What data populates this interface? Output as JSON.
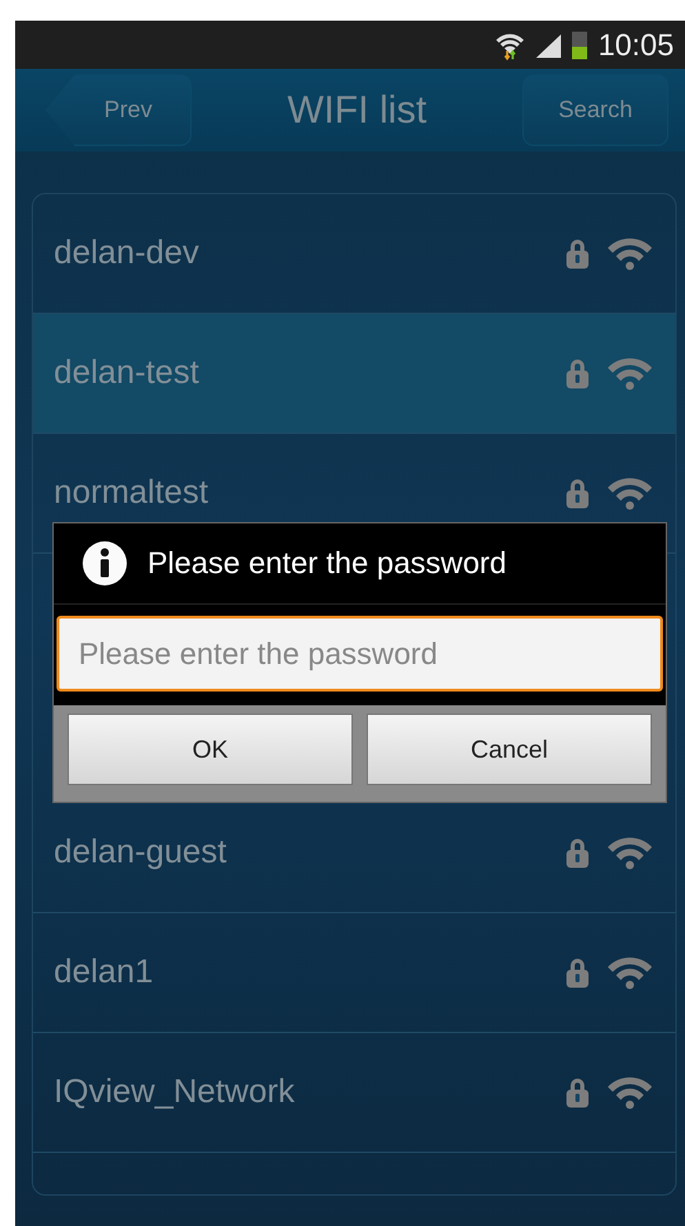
{
  "status_bar": {
    "time": "10:05"
  },
  "header": {
    "back_button": "Prev",
    "title": "WIFI list",
    "action_button": "Search"
  },
  "networks": [
    {
      "name": "delan-dev",
      "secured": true,
      "selected": false
    },
    {
      "name": "delan-test",
      "secured": true,
      "selected": true
    },
    {
      "name": "normaltest",
      "secured": true,
      "selected": false
    },
    {
      "name": "delan-guest",
      "secured": true,
      "selected": false
    },
    {
      "name": "delan1",
      "secured": true,
      "selected": false
    },
    {
      "name": "IQview_Network",
      "secured": true,
      "selected": false
    }
  ],
  "dialog": {
    "title": "Please enter the password",
    "password_field": {
      "placeholder": "Please enter the password"
    },
    "buttons": [
      "OK",
      "Cancel"
    ]
  }
}
